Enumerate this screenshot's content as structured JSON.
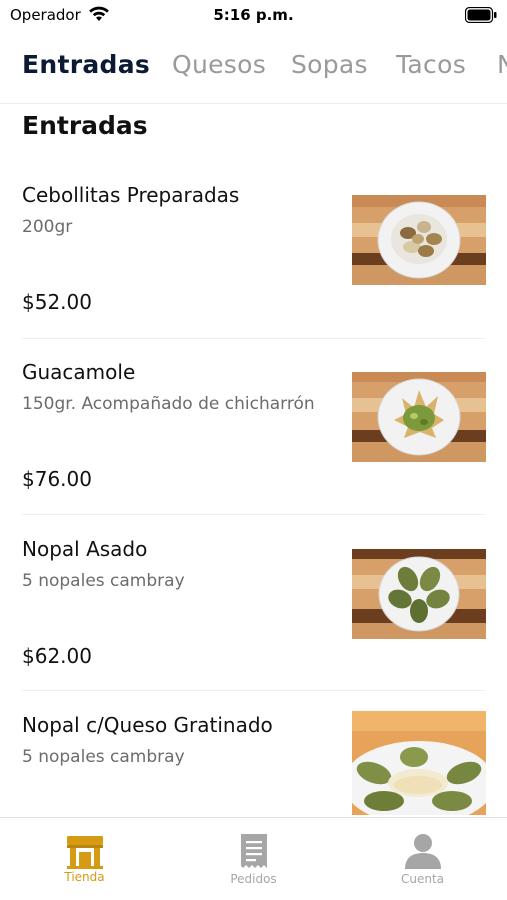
{
  "status_bar": {
    "carrier": "Operador",
    "time": "5:16 p.m.",
    "wifi_icon": "wifi-icon",
    "battery_icon": "battery-icon"
  },
  "categories": {
    "tabs": [
      "Entradas",
      "Quesos",
      "Sopas",
      "Tacos",
      "N"
    ],
    "selected": "Entradas"
  },
  "section": {
    "title": "Entradas"
  },
  "items": [
    {
      "name": "Cebollitas Preparadas",
      "description": "200gr",
      "price": "$52.00",
      "photo_icon": "cebollitas-photo"
    },
    {
      "name": "Guacamole",
      "description": "150gr. Acompañado de chicharrón",
      "price": "$76.00",
      "photo_icon": "guacamole-photo"
    },
    {
      "name": "Nopal Asado",
      "description": "5 nopales cambray",
      "price": "$62.00",
      "photo_icon": "nopal-photo"
    },
    {
      "name": "Nopal c/Queso Gratinado",
      "description": "5 nopales cambray",
      "price": "",
      "photo_icon": "nopal-queso-photo"
    }
  ],
  "tabbar": {
    "items": [
      {
        "label": "Tienda",
        "icon": "store-icon",
        "active": true
      },
      {
        "label": "Pedidos",
        "icon": "receipt-icon",
        "active": false
      },
      {
        "label": "Cuenta",
        "icon": "person-icon",
        "active": false
      }
    ]
  },
  "colors": {
    "active_category": "#0c1a33",
    "inactive_category": "#9a9a9a",
    "tabbar_active": "#d59b12",
    "tabbar_inactive": "#a6a6a6"
  }
}
